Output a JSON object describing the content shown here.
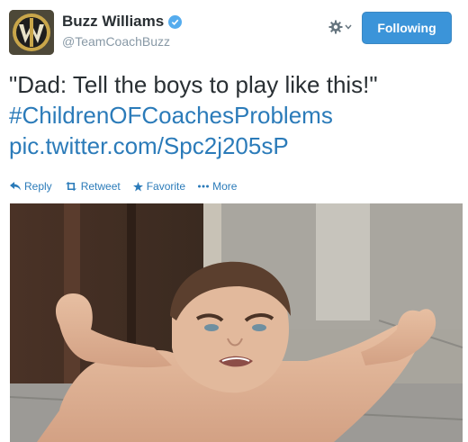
{
  "profile": {
    "name": "Buzz Williams",
    "handle": "@TeamCoachBuzz",
    "verified": true
  },
  "header": {
    "follow_label": "Following",
    "menu_icon": "gear-icon"
  },
  "tweet": {
    "quote": "\"Dad: Tell the boys to play like this!\"",
    "hashtag": "#ChildrenOFCoachesProblems",
    "link": "pic.twitter.com/Spc2j205sP"
  },
  "actions": {
    "reply": "Reply",
    "retweet": "Retweet",
    "favorite": "Favorite",
    "more": "More"
  },
  "colors": {
    "link": "#2b7bb9",
    "follow_button": "#3b94d9",
    "verified_badge": "#55acee"
  }
}
